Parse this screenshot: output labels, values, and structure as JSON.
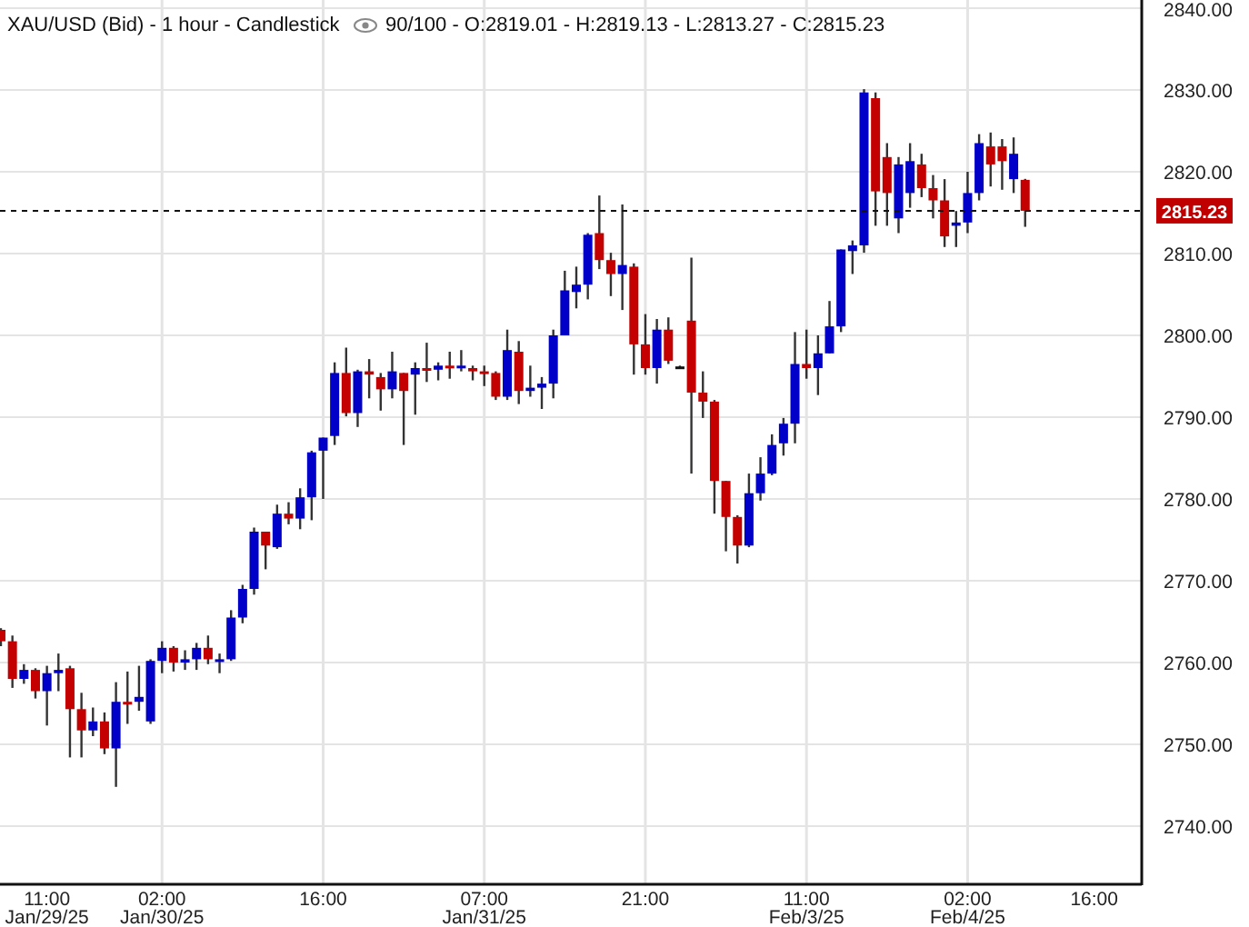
{
  "chart": {
    "title": "XAU/USD (Bid) - 1 hour - Candlestick",
    "quote": "90/100 - O:2819.01 - H:2819.13 - L:2813.27 - C:2815.23",
    "chart_data": {
      "type": "candlestick",
      "ylim": [
        2733,
        2841
      ],
      "grid": true,
      "ref_lines": [
        {
          "axis": "y",
          "value": 2815.23,
          "label": "2815.23"
        }
      ],
      "yticks": [
        {
          "value": 2840,
          "label": "2840.00"
        },
        {
          "value": 2830,
          "label": "2830.00"
        },
        {
          "value": 2820,
          "label": "2820.00"
        },
        {
          "value": 2810,
          "label": "2810.00"
        },
        {
          "value": 2800,
          "label": "2800.00"
        },
        {
          "value": 2790,
          "label": "2790.00"
        },
        {
          "value": 2780,
          "label": "2780.00"
        },
        {
          "value": 2770,
          "label": "2770.00"
        },
        {
          "value": 2760,
          "label": "2760.00"
        },
        {
          "value": 2750,
          "label": "2750.00"
        },
        {
          "value": 2740,
          "label": "2740.00"
        }
      ],
      "categories": [
        null,
        null,
        null,
        null,
        "11:00\nJan/29/25",
        null,
        null,
        null,
        null,
        null,
        null,
        null,
        null,
        null,
        "02:00\nJan/30/25",
        null,
        null,
        null,
        null,
        null,
        null,
        null,
        null,
        null,
        null,
        null,
        null,
        null,
        "16:00",
        null,
        null,
        null,
        null,
        null,
        null,
        null,
        null,
        null,
        null,
        null,
        null,
        null,
        "07:00\nJan/31/25",
        null,
        null,
        null,
        null,
        null,
        null,
        null,
        null,
        null,
        null,
        null,
        null,
        null,
        "21:00",
        null,
        null,
        null,
        null,
        null,
        null,
        null,
        null,
        null,
        null,
        null,
        null,
        null,
        "11:00\nFeb/3/25",
        null,
        null,
        null,
        null,
        null,
        null,
        null,
        null,
        null,
        null,
        null,
        null,
        null,
        "02:00\nFeb/4/25",
        null,
        null,
        null,
        null,
        null,
        null,
        null,
        null,
        null,
        null,
        "16:00"
      ],
      "ohlc": [
        [
          2764.0,
          2764.2,
          2762.0,
          2762.6
        ],
        [
          2762.6,
          2763.3,
          2756.9,
          2758.0
        ],
        [
          2758.0,
          2759.8,
          2757.4,
          2759.1
        ],
        [
          2759.1,
          2759.3,
          2755.6,
          2756.5
        ],
        [
          2756.5,
          2759.6,
          2752.3,
          2758.7
        ],
        [
          2758.7,
          2761.1,
          2756.5,
          2759.1
        ],
        [
          2759.3,
          2759.6,
          2748.4,
          2754.3
        ],
        [
          2754.3,
          2756.3,
          2748.4,
          2751.7
        ],
        [
          2751.7,
          2754.5,
          2751.0,
          2752.8
        ],
        [
          2752.8,
          2753.9,
          2748.8,
          2749.5
        ],
        [
          2749.5,
          2757.6,
          2744.8,
          2755.2
        ],
        [
          2755.2,
          2758.9,
          2752.5,
          2755.0
        ],
        [
          2755.2,
          2759.6,
          2754.1,
          2755.8
        ],
        [
          2752.8,
          2760.4,
          2752.5,
          2760.2
        ],
        [
          2760.2,
          2762.6,
          2758.7,
          2761.8
        ],
        [
          2761.8,
          2762.0,
          2758.9,
          2760.0
        ],
        [
          2760.0,
          2761.5,
          2759.1,
          2760.4
        ],
        [
          2760.4,
          2762.4,
          2759.1,
          2761.8
        ],
        [
          2761.8,
          2763.3,
          2759.8,
          2760.4
        ],
        [
          2760.2,
          2761.1,
          2758.7,
          2760.4
        ],
        [
          2760.4,
          2766.4,
          2760.2,
          2765.5
        ],
        [
          2765.5,
          2769.5,
          2764.8,
          2769.0
        ],
        [
          2769.0,
          2776.5,
          2768.3,
          2776.0
        ],
        [
          2776.0,
          2776.0,
          2771.4,
          2774.3
        ],
        [
          2774.1,
          2779.3,
          2773.9,
          2778.2
        ],
        [
          2778.2,
          2779.6,
          2776.9,
          2777.6
        ],
        [
          2777.6,
          2781.3,
          2776.3,
          2780.2
        ],
        [
          2780.2,
          2785.9,
          2777.4,
          2785.7
        ],
        [
          2785.9,
          2787.5,
          2780.0,
          2787.5
        ],
        [
          2787.7,
          2796.7,
          2786.6,
          2795.4
        ],
        [
          2795.4,
          2798.5,
          2790.1,
          2790.5
        ],
        [
          2790.5,
          2795.8,
          2788.8,
          2795.6
        ],
        [
          2795.6,
          2797.1,
          2792.3,
          2795.2
        ],
        [
          2794.9,
          2795.4,
          2790.8,
          2793.4
        ],
        [
          2793.4,
          2798.0,
          2792.3,
          2795.6
        ],
        [
          2795.4,
          2795.4,
          2786.6,
          2793.2
        ],
        [
          2795.2,
          2796.7,
          2790.3,
          2796.0
        ],
        [
          2796.0,
          2799.1,
          2794.3,
          2795.8
        ],
        [
          2795.8,
          2796.7,
          2794.5,
          2796.3
        ],
        [
          2796.3,
          2798.0,
          2794.7,
          2796.0
        ],
        [
          2796.0,
          2798.2,
          2795.6,
          2796.3
        ],
        [
          2796.0,
          2796.3,
          2794.5,
          2795.6
        ],
        [
          2795.6,
          2796.3,
          2793.8,
          2795.4
        ],
        [
          2795.4,
          2795.6,
          2792.1,
          2792.5
        ],
        [
          2792.5,
          2800.7,
          2792.1,
          2798.2
        ],
        [
          2798.0,
          2799.3,
          2791.6,
          2793.2
        ],
        [
          2793.2,
          2796.3,
          2792.5,
          2793.6
        ],
        [
          2793.6,
          2794.9,
          2791.0,
          2794.1
        ],
        [
          2794.1,
          2800.7,
          2792.3,
          2800.0
        ],
        [
          2800.0,
          2807.9,
          2800.0,
          2805.5
        ],
        [
          2805.3,
          2808.4,
          2803.3,
          2806.2
        ],
        [
          2806.2,
          2812.5,
          2804.4,
          2812.3
        ],
        [
          2812.5,
          2817.1,
          2808.1,
          2809.2
        ],
        [
          2809.2,
          2810.1,
          2804.8,
          2807.5
        ],
        [
          2807.5,
          2816.0,
          2803.1,
          2808.6
        ],
        [
          2808.4,
          2808.8,
          2795.2,
          2798.9
        ],
        [
          2798.9,
          2802.6,
          2795.2,
          2796.0
        ],
        [
          2796.0,
          2802.0,
          2794.1,
          2800.7
        ],
        [
          2800.7,
          2802.2,
          2796.5,
          2796.9
        ],
        [
          2796.2,
          2796.3,
          2796.0,
          2796.2
        ],
        [
          2801.8,
          2809.5,
          2783.1,
          2793.0
        ],
        [
          2793.0,
          2795.6,
          2789.9,
          2791.9
        ],
        [
          2791.9,
          2792.1,
          2778.2,
          2782.2
        ],
        [
          2782.2,
          2782.2,
          2773.6,
          2777.8
        ],
        [
          2777.8,
          2778.0,
          2772.1,
          2774.3
        ],
        [
          2774.3,
          2783.1,
          2774.1,
          2780.7
        ],
        [
          2780.7,
          2785.1,
          2779.8,
          2783.1
        ],
        [
          2783.1,
          2787.9,
          2782.9,
          2786.6
        ],
        [
          2786.8,
          2789.9,
          2785.3,
          2789.2
        ],
        [
          2789.2,
          2800.4,
          2786.8,
          2796.5
        ],
        [
          2796.5,
          2800.7,
          2794.7,
          2796.0
        ],
        [
          2796.0,
          2800.0,
          2792.7,
          2797.8
        ],
        [
          2797.8,
          2804.2,
          2797.8,
          2801.1
        ],
        [
          2801.1,
          2810.5,
          2800.4,
          2810.5
        ],
        [
          2810.3,
          2811.6,
          2807.5,
          2811.0
        ],
        [
          2811.0,
          2830.1,
          2810.1,
          2829.7
        ],
        [
          2829.0,
          2829.7,
          2813.4,
          2817.6
        ],
        [
          2821.8,
          2823.5,
          2813.4,
          2817.4
        ],
        [
          2814.3,
          2821.8,
          2812.5,
          2820.9
        ],
        [
          2817.4,
          2823.5,
          2815.6,
          2821.3
        ],
        [
          2820.9,
          2822.2,
          2816.9,
          2818.0
        ],
        [
          2818.0,
          2819.6,
          2814.3,
          2816.5
        ],
        [
          2816.5,
          2819.1,
          2810.8,
          2812.1
        ],
        [
          2813.4,
          2815.2,
          2810.8,
          2813.8
        ],
        [
          2813.8,
          2820.0,
          2812.5,
          2817.4
        ],
        [
          2817.4,
          2824.6,
          2816.5,
          2823.5
        ],
        [
          2823.1,
          2824.8,
          2818.2,
          2820.9
        ],
        [
          2823.1,
          2824.0,
          2817.8,
          2821.3
        ],
        [
          2819.1,
          2824.2,
          2817.4,
          2822.2
        ],
        [
          2819.01,
          2819.13,
          2813.27,
          2815.23
        ],
        null,
        null,
        null,
        null,
        null,
        null
      ]
    }
  }
}
